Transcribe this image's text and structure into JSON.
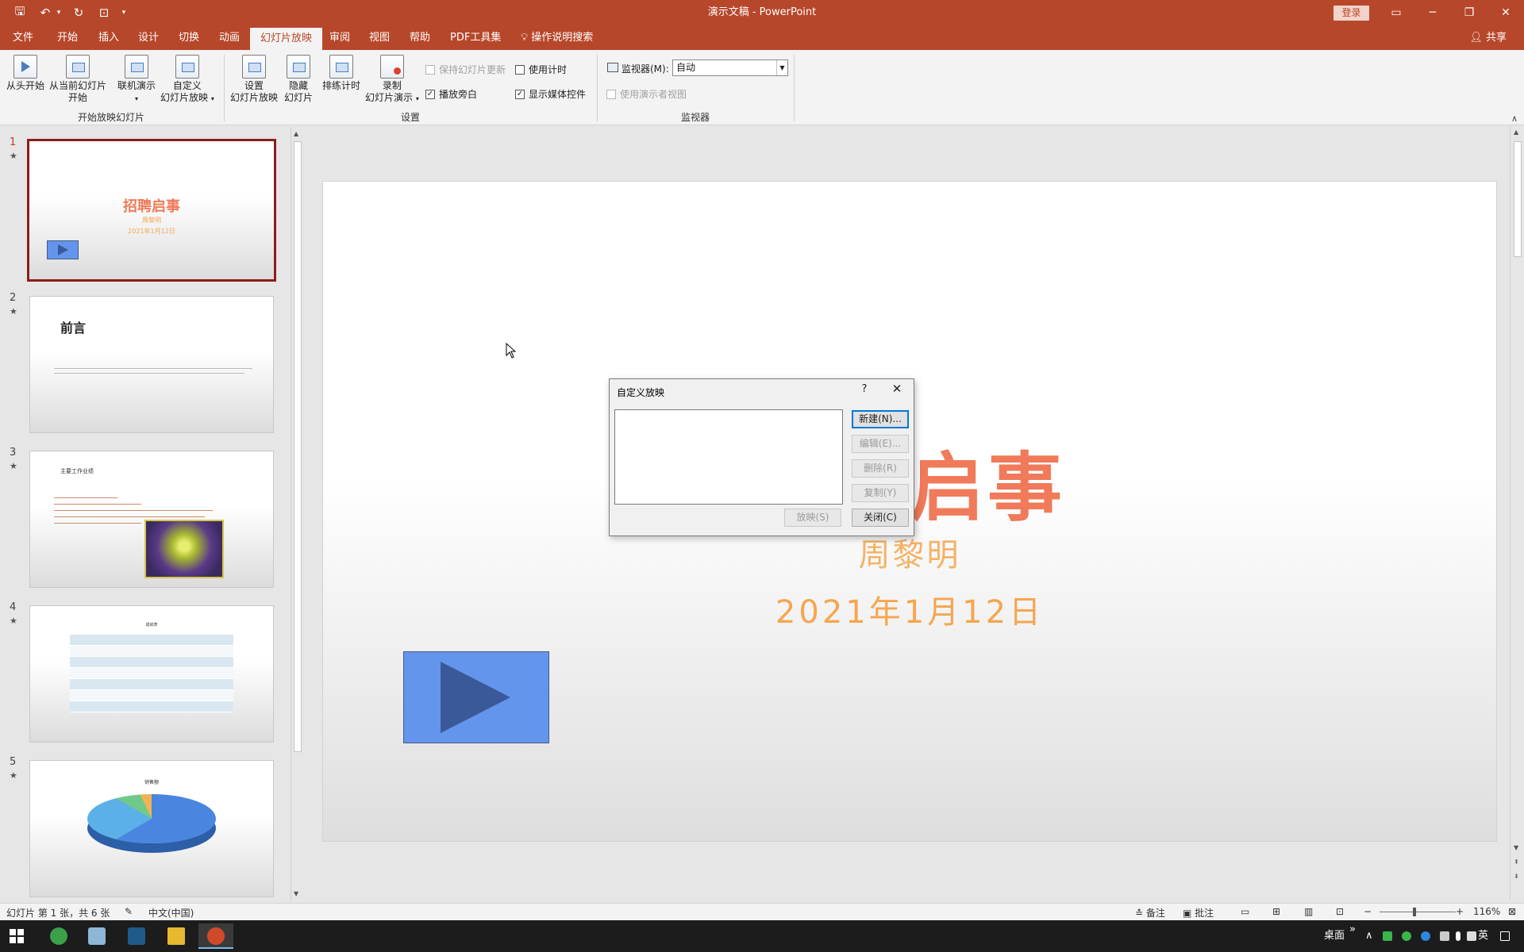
{
  "titlebar": {
    "doc_title": "演示文稿  -  PowerPoint",
    "login": "登录",
    "qat": {
      "save": "🖫",
      "undo": "↶",
      "undo_more": "▾",
      "redo": "↻",
      "present": "⊡",
      "customize": "▾"
    },
    "controls": {
      "ribbon_display": "▭",
      "minimize": "─",
      "restore": "❐",
      "close": "✕"
    }
  },
  "tabs": [
    "文件",
    "开始",
    "插入",
    "设计",
    "切换",
    "动画",
    "幻灯片放映",
    "审阅",
    "视图",
    "帮助",
    "PDF工具集",
    "操作说明搜索"
  ],
  "active_tab": "幻灯片放映",
  "share": "共享",
  "ribbon": {
    "start_group": {
      "label": "开始放映幻灯片",
      "from_beginning": "从头开始",
      "from_current_1": "从当前幻灯片",
      "from_current_2": "开始",
      "online": "联机演示",
      "custom_1": "自定义",
      "custom_2": "幻灯片放映"
    },
    "setup_group": {
      "label": "设置",
      "setup_1": "设置",
      "setup_2": "幻灯片放映",
      "hide_1": "隐藏",
      "hide_2": "幻灯片",
      "rehearse": "排练计时",
      "record_1": "录制",
      "record_2": "幻灯片演示",
      "keep_updated": "保持幻灯片更新",
      "play_narration": "播放旁白",
      "use_timings": "使用计时",
      "show_media": "显示媒体控件"
    },
    "monitor_group": {
      "label": "监视器",
      "monitor_label": "监视器(M):",
      "monitor_value": "自动",
      "presenter_view": "使用演示者视图"
    }
  },
  "thumbnails": [
    {
      "num": "1",
      "title": "招聘启事",
      "sub": "周黎明",
      "date": "2021年1月12日"
    },
    {
      "num": "2",
      "title": "前言"
    },
    {
      "num": "3",
      "title": "主要工作业绩"
    },
    {
      "num": "4",
      "title": "成绩表"
    },
    {
      "num": "5",
      "title": "销售额"
    }
  ],
  "slide": {
    "title": "招聘启事",
    "subtitle": "周黎明",
    "date": "2021年1月12日"
  },
  "dialog": {
    "title": "自定义放映",
    "help": "?",
    "close": "✕",
    "new": "新建(N)...",
    "edit": "编辑(E)...",
    "delete": "删除(R)",
    "copy": "复制(Y)",
    "show": "放映(S)",
    "close_btn": "关闭(C)"
  },
  "statusbar": {
    "slide_info": "幻灯片 第 1 张，共 6 张",
    "language": "中文(中国)",
    "notes": "备注",
    "comments": "批注",
    "zoom_minus": "−",
    "zoom_plus": "+",
    "zoom": "116%"
  },
  "taskbar": {
    "desktop": "桌面",
    "ime": "英",
    "chevron": "»",
    "up": "∧"
  }
}
